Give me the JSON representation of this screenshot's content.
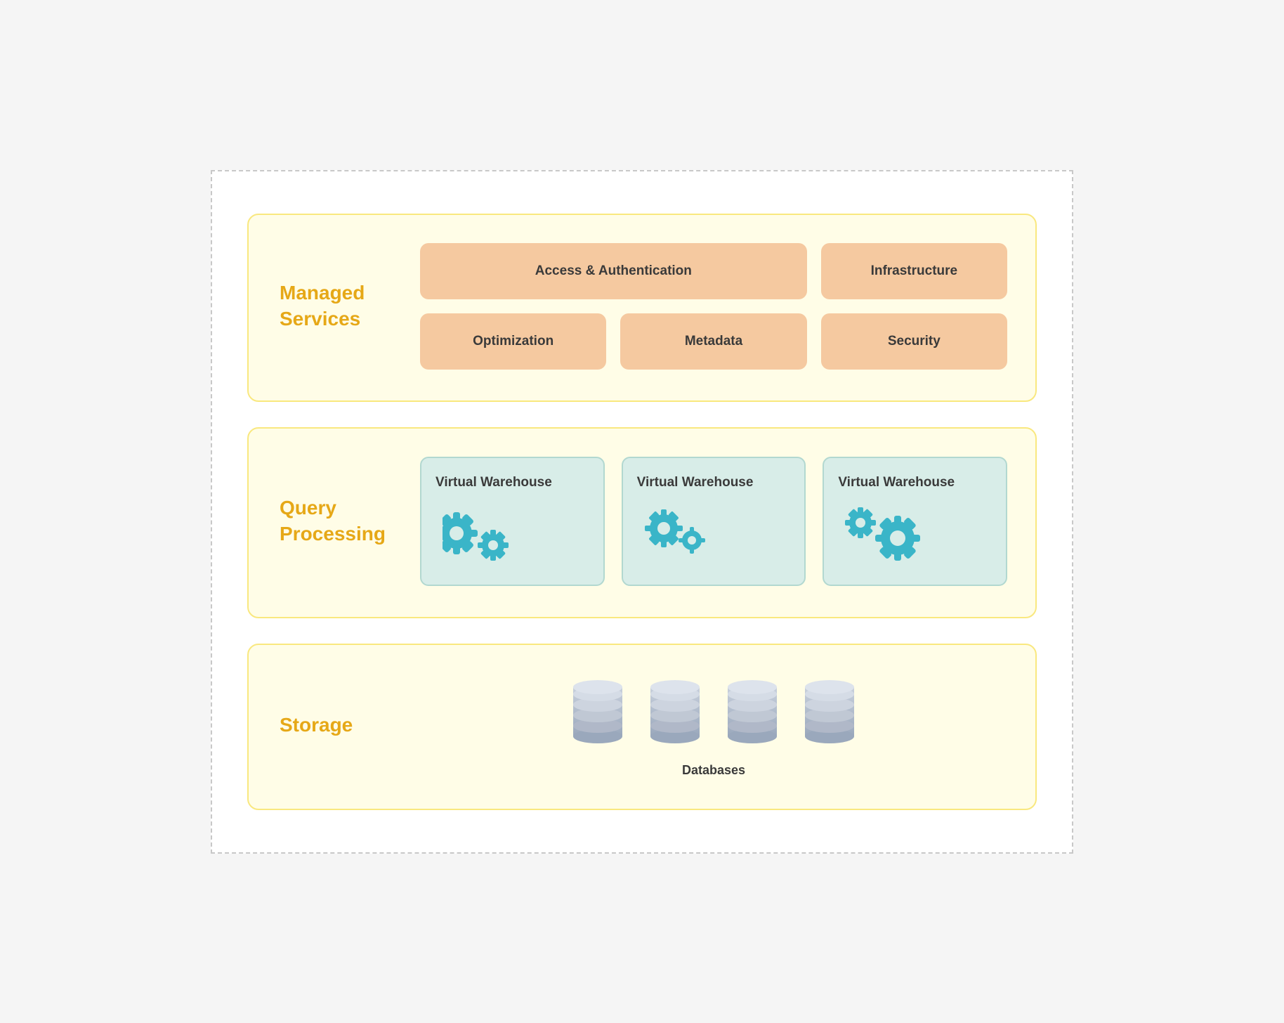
{
  "outer": {
    "bg": "#ffffff"
  },
  "managed_services": {
    "label_line1": "Managed",
    "label_line2": "Services",
    "cards": [
      {
        "id": "access-auth",
        "label": "Access & Authentication",
        "wide": true
      },
      {
        "id": "infrastructure",
        "label": "Infrastructure",
        "wide": false
      },
      {
        "id": "optimization",
        "label": "Optimization",
        "wide": false
      },
      {
        "id": "metadata",
        "label": "Metadata",
        "wide": false
      },
      {
        "id": "security",
        "label": "Security",
        "wide": false
      }
    ]
  },
  "query_processing": {
    "label_line1": "Query",
    "label_line2": "Processing",
    "warehouses": [
      {
        "id": "vw1",
        "label": "Virtual Warehouse",
        "gear_size": "large"
      },
      {
        "id": "vw2",
        "label": "Virtual Warehouse",
        "gear_size": "medium"
      },
      {
        "id": "vw3",
        "label": "Virtual Warehouse",
        "gear_size": "large"
      }
    ]
  },
  "storage": {
    "label": "Storage",
    "databases_label": "Databases",
    "db_count": 4
  }
}
